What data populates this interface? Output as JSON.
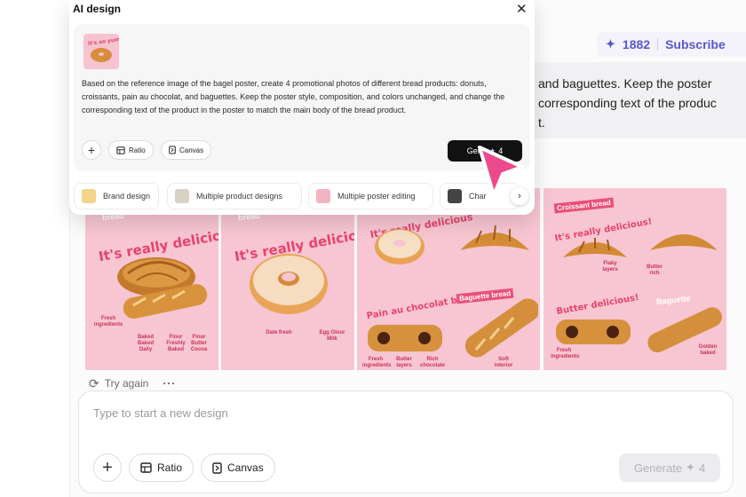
{
  "modal": {
    "title": "AI design",
    "prompt": "Based on the reference image of the bagel poster, create 4 promotional photos of different bread products: donuts, croissants, pain au chocolat, and baguettes. Keep the poster style, composition, and colors unchanged, and change the corresponding text of the product in the poster to match the main body of the bread product.",
    "ratio_label": "Ratio",
    "canvas_label": "Canvas",
    "generate_label": "Gene",
    "generate_cost": "4",
    "chips": [
      "Brand design",
      "Multiple product designs",
      "Multiple poster editing",
      "Char"
    ]
  },
  "header": {
    "credits": "1882",
    "subscribe": "Subscribe"
  },
  "background_message": {
    "lines": [
      "and baguettes. Keep the poster",
      "corresponding text of the produc",
      "t."
    ]
  },
  "gallery": {
    "tile1": {
      "badge": "bread",
      "headline": "It's really delicious!",
      "captions": [
        "Fresh ingredients",
        "Baked Baked Daily",
        "Flour Freshly Baked",
        "Flour Butter Cocoa"
      ]
    },
    "tile2": {
      "badge": "bread",
      "headline": "It's really delicious!",
      "captions": [
        "Date fresh",
        "Egg Glour Milk"
      ]
    },
    "tile3": {
      "headline_top": "It's really delicious",
      "headline_mid": "Pain au chocolat bread",
      "title_badge": "Baguette bread",
      "captions": [
        "Fresh ingredients",
        "Butter layers",
        "Rich chocolate",
        "Soft interior"
      ]
    },
    "tile4": {
      "badge": "Croissant bread",
      "headline": "It's really delicious!",
      "headline_mid": "Butter delicious!",
      "title_badge": "Baguette",
      "captions": [
        "Flaky layers",
        "Butter rich",
        "Fresh ingredients",
        "Golden baked"
      ]
    }
  },
  "retry_label": "Try again",
  "composer": {
    "placeholder": "Type to start a new design",
    "ratio_label": "Ratio",
    "canvas_label": "Canvas",
    "generate_label": "Generate",
    "generate_cost": "4"
  },
  "colors": {
    "accent": "#5a56c9",
    "poster_pink": "#f7c6d2",
    "poster_text": "#e8426d",
    "cursor": "#ec4a8c"
  }
}
